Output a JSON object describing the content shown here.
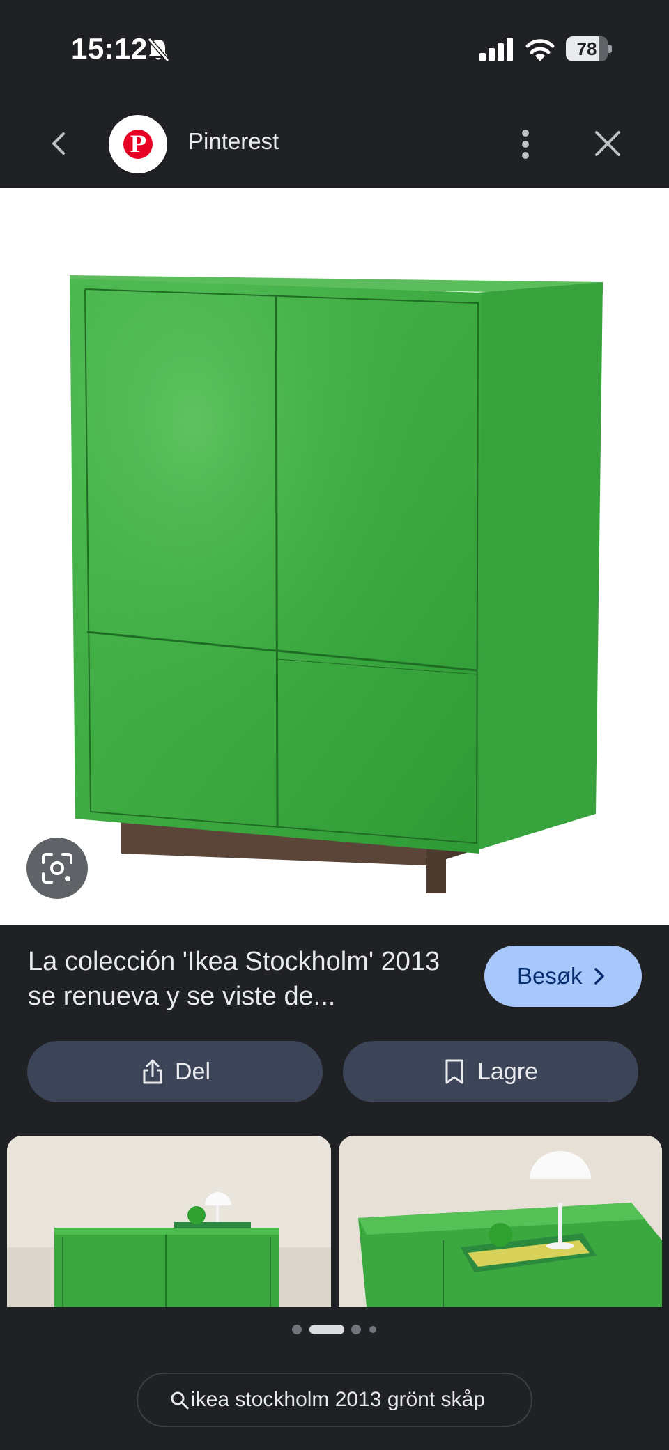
{
  "status_bar": {
    "time": "15:12",
    "battery": "78",
    "battery_level": 0.78,
    "icons": [
      "bell-off-icon",
      "signal-icon",
      "wifi-icon",
      "battery-icon"
    ]
  },
  "header": {
    "site_name": "Pinterest",
    "logo_letter": "P",
    "icons": [
      "back-arrow-icon",
      "pinterest-logo",
      "more-vert-icon",
      "close-icon"
    ]
  },
  "result": {
    "title": "La colección 'Ikea Stockholm' 2013 se renueva y se viste de...",
    "visit_label": "Besøk",
    "share_label": "Del",
    "save_label": "Lagre"
  },
  "pager": {
    "count": 4,
    "active": 1
  },
  "search": {
    "query": "ikea stockholm 2013 grönt skåp"
  },
  "colors": {
    "background": "#202124",
    "visit_button": "#a8c7fa",
    "action_button": "#3c4558",
    "pinterest_red": "#e60023",
    "cabinet_green": "#3aa83f"
  }
}
